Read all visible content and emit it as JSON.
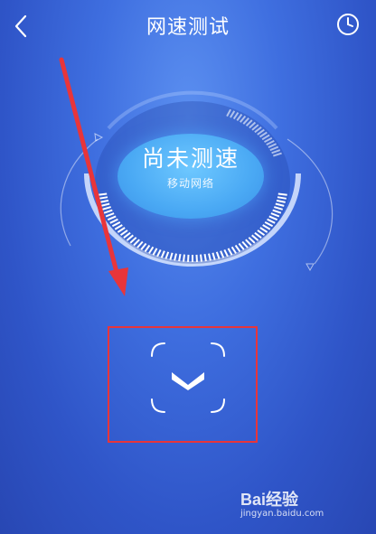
{
  "header": {
    "title": "网速测试",
    "back_icon": "chevron-left-icon",
    "history_icon": "clock-icon"
  },
  "gauge": {
    "status": "尚未测速",
    "network": "移动网络"
  },
  "start_button": {
    "icon": "chevron-down-icon"
  },
  "watermark": {
    "brand": "Bai经验",
    "url": "jingyan.baidu.com"
  },
  "colors": {
    "background": "#3f6fe0",
    "status_circle": "#4aa9f4",
    "annotation_red": "#e8353a"
  }
}
